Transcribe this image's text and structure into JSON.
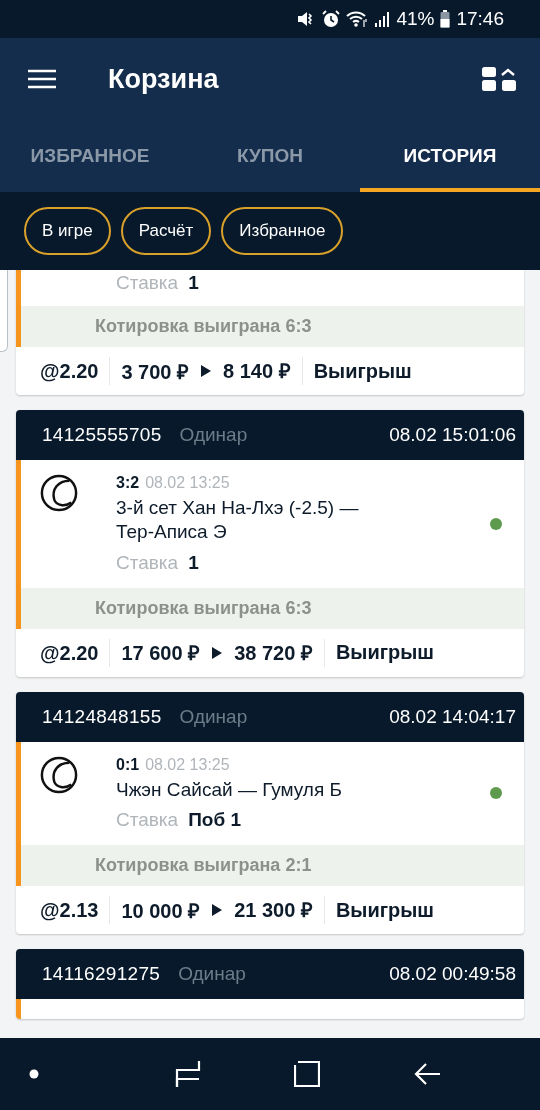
{
  "status_bar": {
    "battery": "41%",
    "time": "17:46"
  },
  "app_bar": {
    "title": "Корзина"
  },
  "tabs": [
    {
      "label": "ИЗБРАННОЕ",
      "selected": false
    },
    {
      "label": "КУПОН",
      "selected": false
    },
    {
      "label": "ИСТОРИЯ",
      "selected": true
    }
  ],
  "filters": [
    {
      "label": "В игре",
      "selected": false
    },
    {
      "label": "Расчёт",
      "selected": false
    },
    {
      "label": "Избранное",
      "selected": false
    }
  ],
  "bets": [
    {
      "partial": true,
      "events": [
        {
          "stake_label": "Ставка",
          "stake": "1"
        }
      ],
      "result": "Котировка выиграна 6:3",
      "odds": "@2.20",
      "amount": "3 700 ₽",
      "payout": "8 140 ₽",
      "outcome": "Выигрыш"
    },
    {
      "number": "14125555705",
      "type": "Одинар",
      "datetime": "08.02 15:01:06",
      "events": [
        {
          "score": "3:2",
          "time": "08.02 13:25",
          "title": "3-й сет Хан На-Лхэ (-2.5) — Тер-Аписа Э",
          "stake_label": "Ставка",
          "stake": "1",
          "won": true
        }
      ],
      "result": "Котировка выиграна 6:3",
      "odds": "@2.20",
      "amount": "17 600 ₽",
      "payout": "38 720 ₽",
      "outcome": "Выигрыш"
    },
    {
      "number": "14124848155",
      "type": "Одинар",
      "datetime": "08.02 14:04:17",
      "events": [
        {
          "score": "0:1",
          "time": "08.02 13:25",
          "title": "Чжэн Сайсай — Гумуля Б",
          "stake_label": "Ставка",
          "stake": "Поб 1",
          "won": true
        }
      ],
      "result": "Котировка выиграна 2:1",
      "odds": "@2.13",
      "amount": "10 000 ₽",
      "payout": "21 300 ₽",
      "outcome": "Выигрыш"
    },
    {
      "number": "14116291275",
      "type": "Одинар",
      "datetime": "08.02 00:49:58"
    }
  ]
}
